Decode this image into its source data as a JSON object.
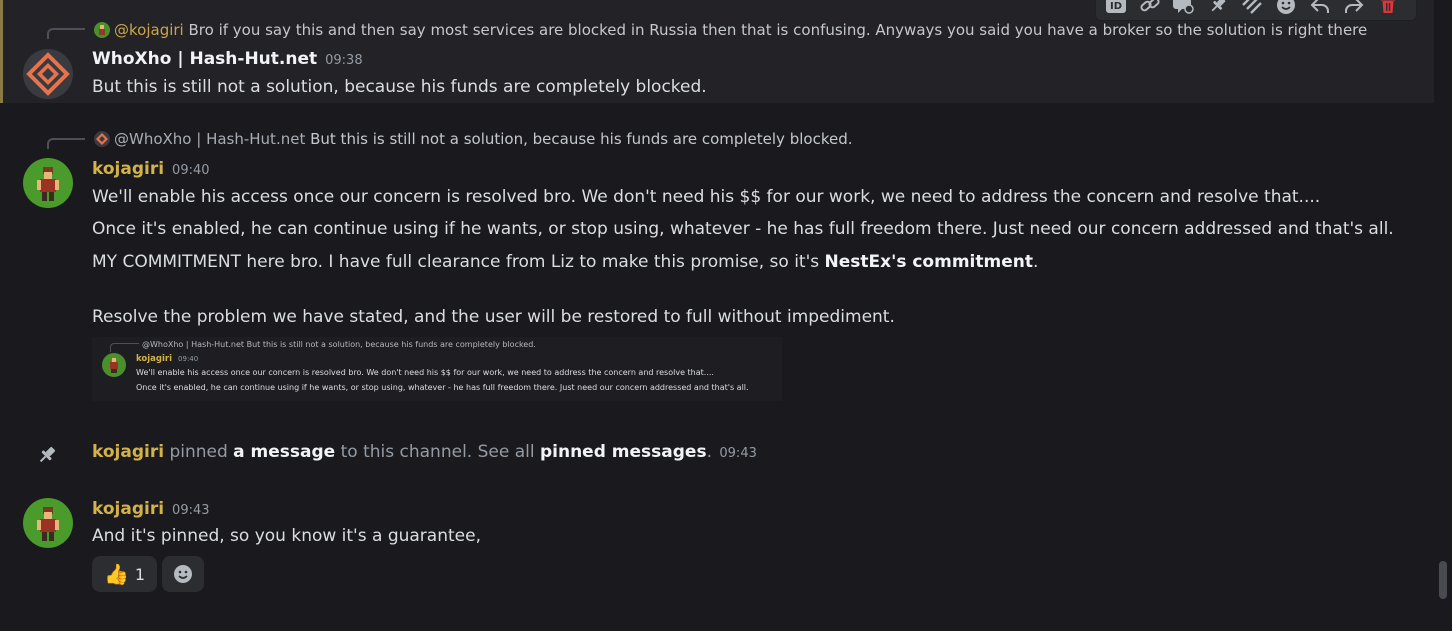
{
  "toolbar": {
    "icons": [
      "id-icon",
      "link-icon",
      "thread-icon",
      "pin-icon",
      "marks-icon",
      "emoji-icon",
      "reply-icon",
      "forward-icon",
      "trash-icon"
    ],
    "id_label": "ID",
    "delete_color": "#da373c"
  },
  "messages": [
    {
      "reply": {
        "mention": "@kojagiri",
        "text": "Bro if you say this and then say most services are blocked in Russia then that is confusing.   Anyways you said you have a broker so the solution is right there"
      },
      "author": "WhoXho | Hash-Hut.net",
      "time": "09:38",
      "text": "But this is still not a solution, because his funds are completely blocked.",
      "highlighted": true
    },
    {
      "reply": {
        "mention": "@WhoXho | Hash-Hut.net",
        "text": "But this is still not a solution, because his funds are completely blocked."
      },
      "author": "kojagiri",
      "time": "09:40",
      "lines": [
        "We'll enable his access once our concern is resolved bro. We don't need his $$ for our work, we need to address the concern and resolve that....",
        "Once it's enabled, he can continue using if he wants, or stop using, whatever - he has full freedom there. Just need our concern addressed and that's all.",
        "MY COMMITMENT here bro. I have full clearance from Liz to make this promise, so it's ",
        "Resolve the problem we have stated, and the user will be restored to full without impediment."
      ],
      "bold_phrase": "NestEx's commitment",
      "bold_suffix": ".",
      "embed": {
        "reply": "@WhoXho | Hash-Hut.net But this is still not a solution, because his funds are completely blocked.",
        "author": "kojagiri",
        "time": "09:40",
        "line1": "We'll enable his access once our concern is resolved bro. We don't need his $$ for our work, we need to address the concern and resolve that....",
        "line2": "Once it's enabled, he can continue using if he wants, or stop using, whatever - he has full freedom there. Just need our concern addressed and that's all."
      }
    }
  ],
  "system": {
    "user": "kojagiri",
    "pinned": " pinned ",
    "link1": "a message",
    "middle": " to this channel. See all ",
    "link2": "pinned messages",
    "end": ".",
    "time": "09:43"
  },
  "last": {
    "author": "kojagiri",
    "time": "09:43",
    "text": "And it's pinned, so you know it's a  guarantee,",
    "reactions": [
      {
        "emoji": "👍",
        "count": "1"
      },
      {
        "emoji": "add-reaction-icon",
        "count": ""
      }
    ]
  },
  "colors": {
    "background": "#1a1a1e",
    "highlight_bar": "#8a7a45",
    "kojagiri_name": "#d4b24a",
    "timestamp": "#949ba4"
  }
}
